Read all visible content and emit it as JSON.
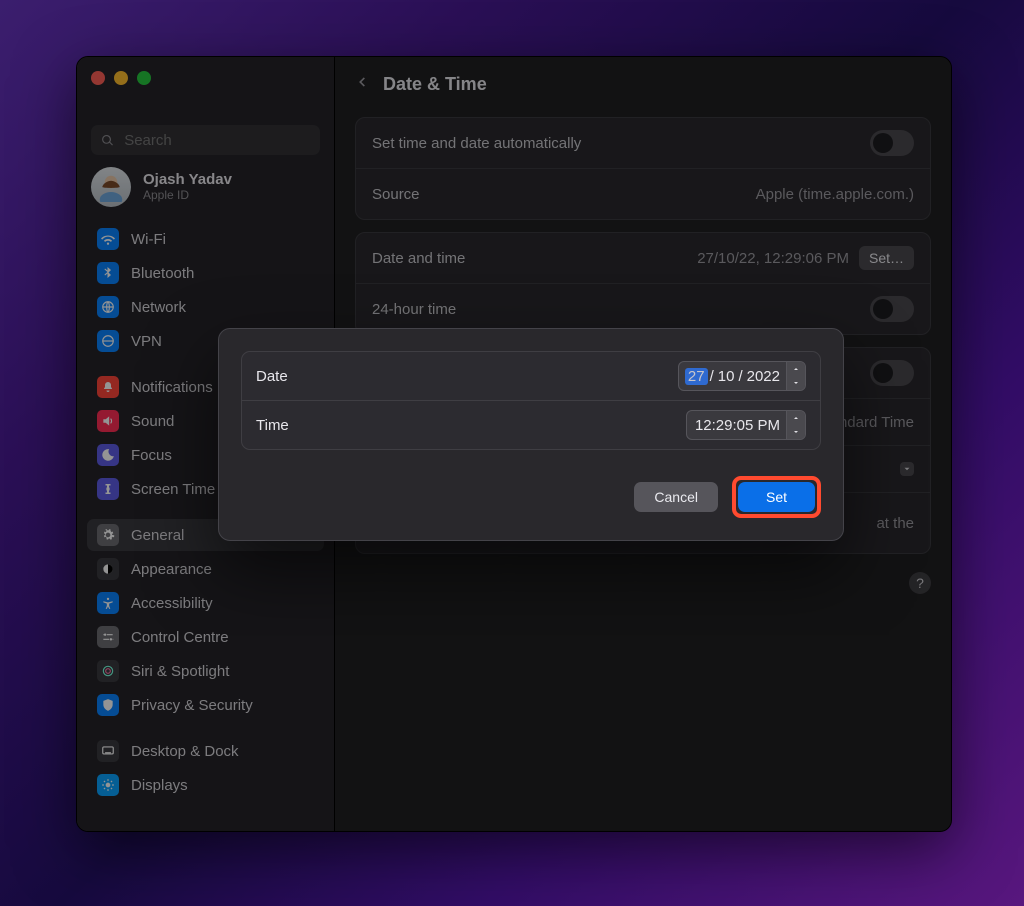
{
  "header": {
    "title": "Date & Time"
  },
  "search": {
    "placeholder": "Search"
  },
  "account": {
    "name": "Ojash Yadav",
    "sub": "Apple ID"
  },
  "sidebar": {
    "items": [
      {
        "label": "Wi-Fi"
      },
      {
        "label": "Bluetooth"
      },
      {
        "label": "Network"
      },
      {
        "label": "VPN"
      },
      {
        "label": "Notifications"
      },
      {
        "label": "Sound"
      },
      {
        "label": "Focus"
      },
      {
        "label": "Screen Time"
      },
      {
        "label": "General"
      },
      {
        "label": "Appearance"
      },
      {
        "label": "Accessibility"
      },
      {
        "label": "Control Centre"
      },
      {
        "label": "Siri & Spotlight"
      },
      {
        "label": "Privacy & Security"
      },
      {
        "label": "Desktop & Dock"
      },
      {
        "label": "Displays"
      }
    ]
  },
  "rows": {
    "auto": "Set time and date automatically",
    "source": "Source",
    "source_val": "Apple (time.apple.com.)",
    "datetime": "Date and time",
    "datetime_val": "27/10/22, 12:29:06 PM",
    "set_btn": "Set…",
    "h24": "24-hour time",
    "tz_fragment": "Standard Time",
    "note_fragment": "at the"
  },
  "sheet": {
    "date_label": "Date",
    "time_label": "Time",
    "date_day": "27",
    "date_sep": "/",
    "date_month": "10",
    "date_year": "2022",
    "time_val": "12:29:05 PM",
    "cancel": "Cancel",
    "set": "Set"
  },
  "help": "?"
}
